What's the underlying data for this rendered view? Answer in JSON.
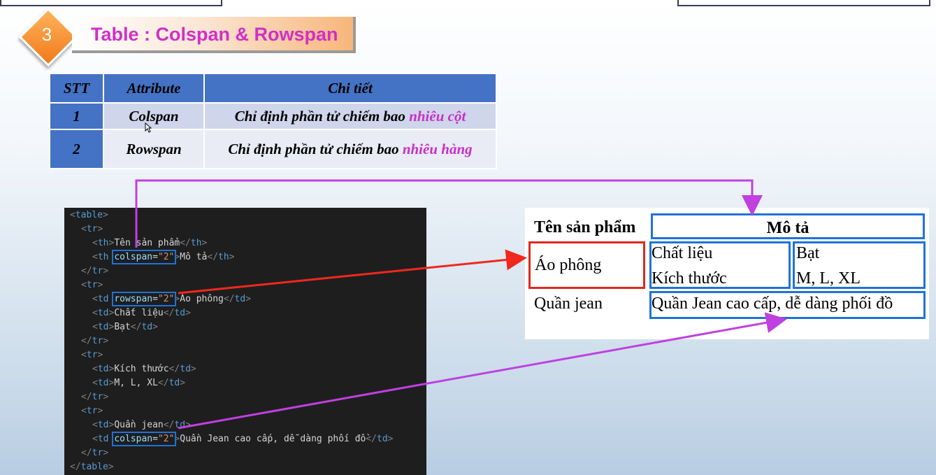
{
  "slide": {
    "number": "3",
    "title": "Table : Colspan & Rowspan"
  },
  "attr_table": {
    "headers": [
      "STT",
      "Attribute",
      "Chi tiết"
    ],
    "rows": [
      {
        "stt": "1",
        "attribute": "Colspan",
        "detail_prefix": "Chỉ định phần tử chiếm bao ",
        "detail_emphasis": "nhiêu cột"
      },
      {
        "stt": "2",
        "attribute": "Rowspan",
        "detail_prefix": "Chỉ định phần tử chiếm bao ",
        "detail_emphasis": "nhiêu hàng"
      }
    ]
  },
  "code": {
    "table_open": "table",
    "table_close": "table",
    "tr": "tr",
    "th": "th",
    "td": "td",
    "attr_colspan": "colspan",
    "attr_rowspan": "rowspan",
    "val_2": "\"2\"",
    "eq": "=",
    "ten_san_pham": "Tên sản phẩm",
    "mo_ta": "Mô tả",
    "ao_phong": "Áo phông",
    "chat_lieu": "Chất liệu",
    "bat": "Bạt",
    "kich_thuoc": "Kích thước",
    "sizes": "M, L, XL",
    "quan_jean": "Quần jean",
    "quan_jean_desc": "Quần Jean cao cấp, dễ dàng phối đồ"
  },
  "output_table": {
    "header_name": "Tên sản phẩm",
    "header_desc": "Mô tả",
    "row1_name": "Áo phông",
    "row1_attr1": "Chất liệu",
    "row1_val1": "Bạt",
    "row2_attr": "Kích thước",
    "row2_val": "M, L, XL",
    "row3_name": "Quần jean",
    "row3_desc": "Quần Jean cao cấp, dễ dàng phối đồ"
  },
  "colors": {
    "title_pink": "#d22fc6",
    "header_blue": "#4472c4",
    "arrow_red": "#f0281e",
    "arrow_purple": "#c040e0",
    "highlight_blue": "#1f73d6"
  }
}
